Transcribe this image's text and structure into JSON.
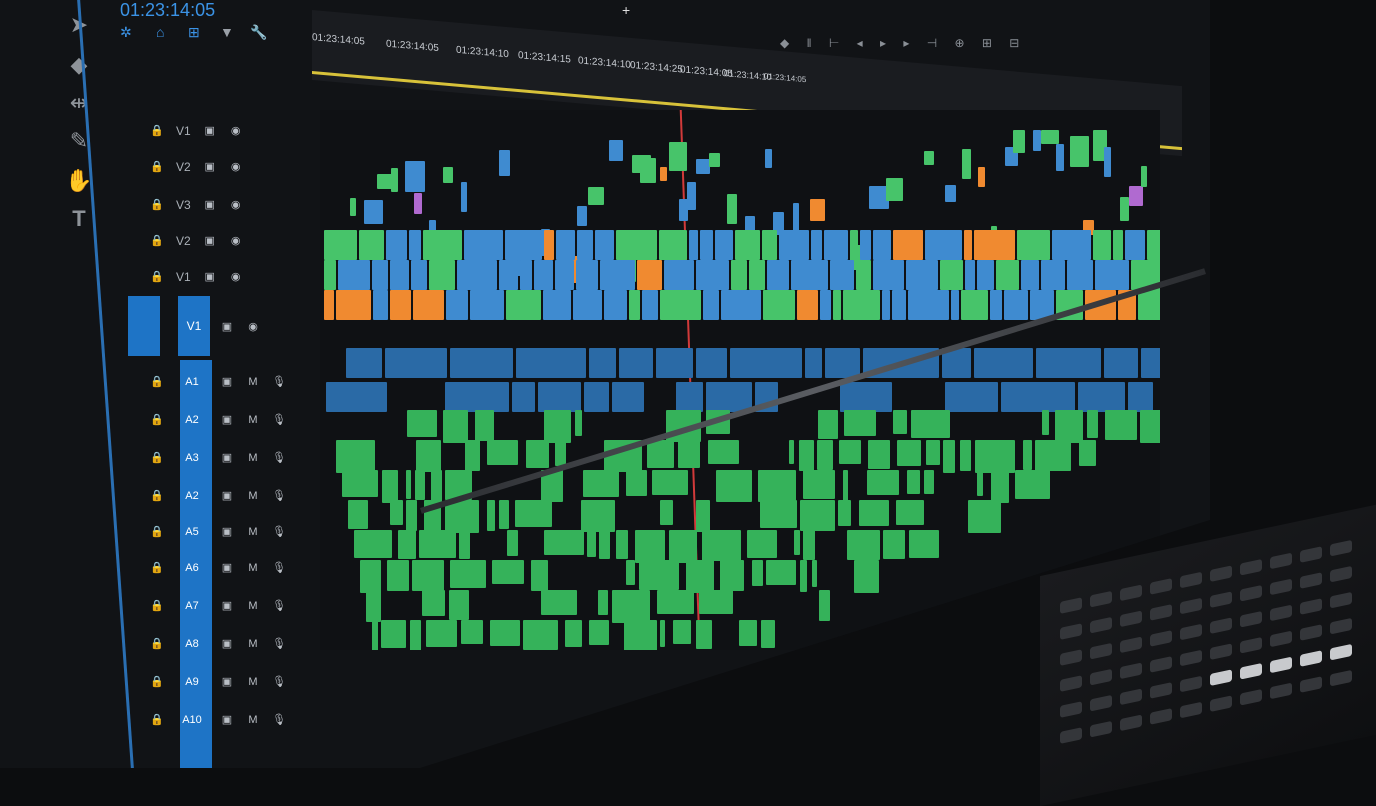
{
  "header": {
    "timecode": "01:23:14:05",
    "ruler_ticks": [
      "01:23:14:05",
      "01:23:14:05",
      "01:23:14:10",
      "01:23:14:15",
      "01:23:14:10",
      "01:23:14:25",
      "01:23:14:05",
      "01:23:14:10",
      "01:23:14:05"
    ],
    "tab_plus": "+"
  },
  "tracks": {
    "video": [
      {
        "label": "V1"
      },
      {
        "label": "V2"
      },
      {
        "label": "V3"
      },
      {
        "label": "V2"
      },
      {
        "label": "V1"
      }
    ],
    "selected_video": {
      "label": "V1"
    },
    "audio": [
      {
        "label": "A1"
      },
      {
        "label": "A2"
      },
      {
        "label": "A3"
      },
      {
        "label": "A2"
      },
      {
        "label": "A5"
      },
      {
        "label": "A6"
      },
      {
        "label": "A7"
      },
      {
        "label": "A8"
      },
      {
        "label": "A9"
      },
      {
        "label": "A10"
      }
    ]
  },
  "colors": {
    "accent_blue": "#1e74c6",
    "clip_video_blue": "#3f8bd0",
    "clip_green": "#47c46a",
    "clip_orange": "#f08a30",
    "playhead": "#d23a3a",
    "work_area_yellow": "#d8c23a"
  },
  "icons": {
    "tools": [
      "selection-icon",
      "razor-icon",
      "ripple-icon",
      "pen-icon",
      "hand-icon",
      "type-icon"
    ],
    "track": [
      "lock-icon",
      "toggle-output-icon",
      "eye-icon",
      "mute-icon",
      "mic-icon"
    ]
  }
}
